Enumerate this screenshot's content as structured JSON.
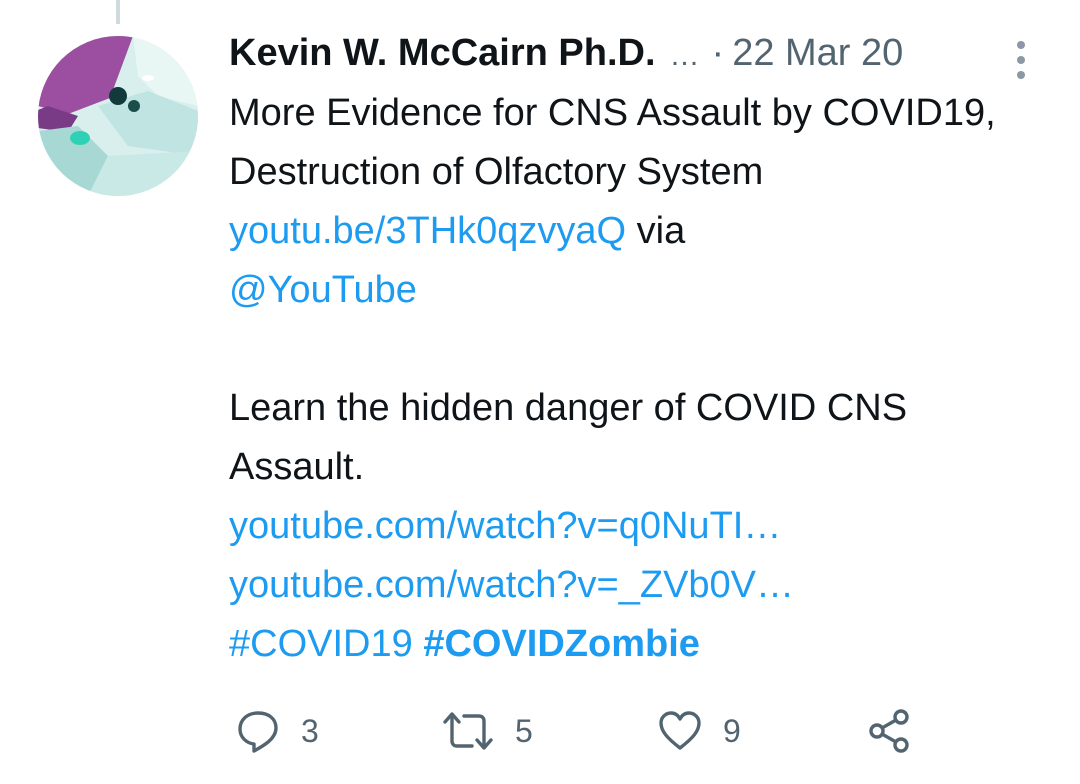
{
  "tweet": {
    "author": {
      "display_name": "Kevin W. McCairn Ph.D.",
      "name_truncation": "…",
      "avatar_icon": "profile-photo"
    },
    "separator": "·",
    "timestamp": "22 Mar 20",
    "more_icon": "vertical-ellipsis-icon",
    "text": {
      "line1_text": "More Evidence for CNS Assault by COVID19, Destruction of Olfactory System ",
      "link1": "youtu.be/3THk0qzvyaQ",
      "via_text": " via",
      "mention": "@YouTube",
      "paragraph2": "Learn the hidden danger of COVID CNS Assault.",
      "link2": "youtube.com/watch?v=q0NuTI…",
      "link3": "youtube.com/watch?v=_ZVb0V…",
      "hashtag1": "#COVID19",
      "hashtag2": "#COVIDZombie"
    },
    "actions": {
      "reply": {
        "icon": "reply-icon",
        "count": "3"
      },
      "retweet": {
        "icon": "retweet-icon",
        "count": "5"
      },
      "like": {
        "icon": "heart-icon",
        "count": "9"
      },
      "share": {
        "icon": "share-icon"
      }
    },
    "colors": {
      "link": "#1d9bf0",
      "text": "#0f1419",
      "secondary": "#536471"
    }
  }
}
